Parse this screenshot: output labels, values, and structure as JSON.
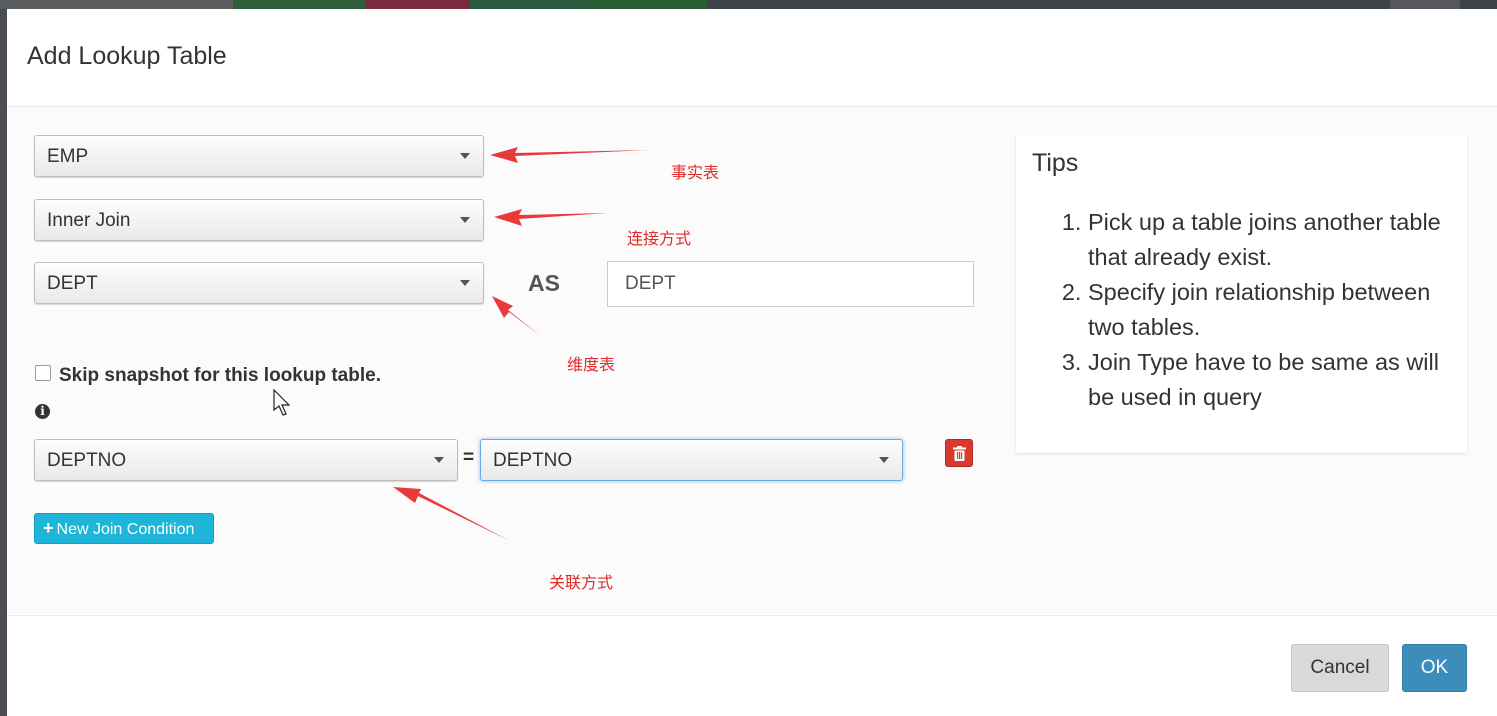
{
  "dialog": {
    "title": "Add Lookup Table"
  },
  "form": {
    "fact_table": "EMP",
    "join_type": "Inner Join",
    "lookup_table": "DEPT",
    "as_label": "AS",
    "alias": "DEPT",
    "skip_snapshot_label": "Skip snapshot for this lookup table.",
    "skip_snapshot_checked": false,
    "info_icon": "info-circle-icon",
    "join_condition": {
      "left_column": "DEPTNO",
      "equals": "=",
      "right_column": "DEPTNO",
      "delete_icon": "trash-icon"
    },
    "new_join_condition_label": "New Join Condition",
    "new_join_condition_icon": "plus-icon"
  },
  "annotations": {
    "fact_table": "事实表",
    "join_type": "连接方式",
    "dimension_table": "维度表",
    "join_relation": "关联方式",
    "color": "#e02a2a"
  },
  "tips": {
    "title": "Tips",
    "items": [
      "Pick up a table joins another table that already exist.",
      "Specify join relationship between two tables.",
      "Join Type have to be same as will be used in query"
    ]
  },
  "footer": {
    "cancel_label": "Cancel",
    "ok_label": "OK"
  },
  "colors": {
    "ok_button": "#3c8dbc",
    "new_join_button": "#1fb5d8",
    "delete_button": "#d9392e",
    "annotation": "#e02a2a"
  }
}
